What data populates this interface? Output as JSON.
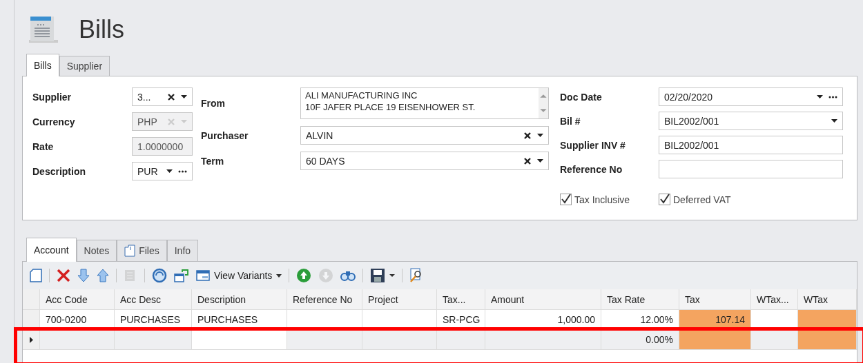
{
  "title": "Bills",
  "form_tabs": [
    {
      "label": "Bills",
      "selected": true
    },
    {
      "label": "Supplier",
      "selected": false
    }
  ],
  "left_fields": [
    {
      "label": "Supplier",
      "value": "3...",
      "clearable": true,
      "dropdown": true,
      "ellipsis": false,
      "disabled": false
    },
    {
      "label": "Currency",
      "value": "PHP",
      "clearable": true,
      "dropdown": true,
      "ellipsis": false,
      "disabled": true
    },
    {
      "label": "Rate",
      "value": "1.0000000",
      "clearable": false,
      "dropdown": false,
      "ellipsis": false,
      "disabled": true
    },
    {
      "label": "Description",
      "value": "PUR",
      "clearable": false,
      "dropdown": true,
      "ellipsis": true,
      "disabled": false
    }
  ],
  "from": {
    "label": "From",
    "lines": [
      "ALI MANUFACTURING INC",
      "10F JAFER PLACE 19 EISENHOWER ST."
    ]
  },
  "middle_fields": [
    {
      "label": "Purchaser",
      "value": "ALVIN",
      "clearable": true,
      "dropdown": true,
      "ellipsis": false,
      "disabled": false
    },
    {
      "label": "Term",
      "value": "60 DAYS",
      "clearable": true,
      "dropdown": true,
      "ellipsis": false,
      "disabled": false
    }
  ],
  "right_fields": [
    {
      "label": "Doc Date",
      "value": "02/20/2020",
      "clearable": false,
      "dropdown": true,
      "ellipsis": true,
      "disabled": false
    },
    {
      "label": "Bil #",
      "value": "BIL2002/001",
      "clearable": false,
      "dropdown": true,
      "ellipsis": false,
      "disabled": false
    },
    {
      "label": "Supplier INV #",
      "value": "BIL2002/001",
      "clearable": false,
      "dropdown": false,
      "ellipsis": false,
      "disabled": false
    },
    {
      "label": "Reference No",
      "clearable": false,
      "dropdown": false,
      "ellipsis": false,
      "disabled": false
    }
  ],
  "checkboxes": [
    {
      "label": "Tax Inclusive",
      "checked": true
    },
    {
      "label": "Deferred VAT",
      "checked": true
    }
  ],
  "grid_tabs": [
    {
      "label": "Account",
      "selected": true,
      "kind": "plain"
    },
    {
      "label": "Notes",
      "selected": false,
      "kind": "plain"
    },
    {
      "label": "Files",
      "selected": false,
      "kind": "attachment"
    },
    {
      "label": "Info",
      "selected": false,
      "kind": "plain"
    }
  ],
  "toolbar": [
    {
      "kind": "new",
      "disabled": false
    },
    {
      "kind": "separator"
    },
    {
      "kind": "delete",
      "disabled": false
    },
    {
      "kind": "down",
      "disabled": false
    },
    {
      "kind": "up",
      "disabled": false
    },
    {
      "kind": "separator"
    },
    {
      "kind": "print",
      "disabled": true
    },
    {
      "kind": "separator"
    },
    {
      "kind": "refresh",
      "disabled": false
    },
    {
      "kind": "restore",
      "disabled": false
    },
    {
      "kind": "variants",
      "label": "View Variants"
    },
    {
      "kind": "separator"
    },
    {
      "kind": "go-up",
      "disabled": false
    },
    {
      "kind": "go-down",
      "disabled": true
    },
    {
      "kind": "find",
      "disabled": false
    },
    {
      "kind": "separator"
    },
    {
      "kind": "save",
      "disabled": false
    },
    {
      "kind": "separator"
    },
    {
      "kind": "preview",
      "disabled": false
    }
  ],
  "table": {
    "columns": [
      {
        "label": "Acc Code"
      },
      {
        "label": "Acc Desc"
      },
      {
        "label": "Description"
      },
      {
        "label": "Reference No"
      },
      {
        "label": "Project"
      },
      {
        "label": "Tax..."
      },
      {
        "label": "Amount"
      },
      {
        "label": "Tax Rate"
      },
      {
        "label": "Tax",
        "color": "#f4a460"
      },
      {
        "label": "WTax..."
      },
      {
        "label": "WTax",
        "color": "#f4a460"
      }
    ],
    "rows": [
      {
        "current": false,
        "cells": [
          "700-0200",
          "PURCHASES",
          "PURCHASES",
          "",
          "",
          "SR-PCG",
          "1,000.00",
          "12.00%",
          "107.14",
          "",
          ""
        ]
      },
      {
        "current": true,
        "cells": [
          "",
          "",
          "",
          "",
          "",
          "",
          "",
          "0.00%",
          "",
          "",
          ""
        ]
      }
    ]
  }
}
